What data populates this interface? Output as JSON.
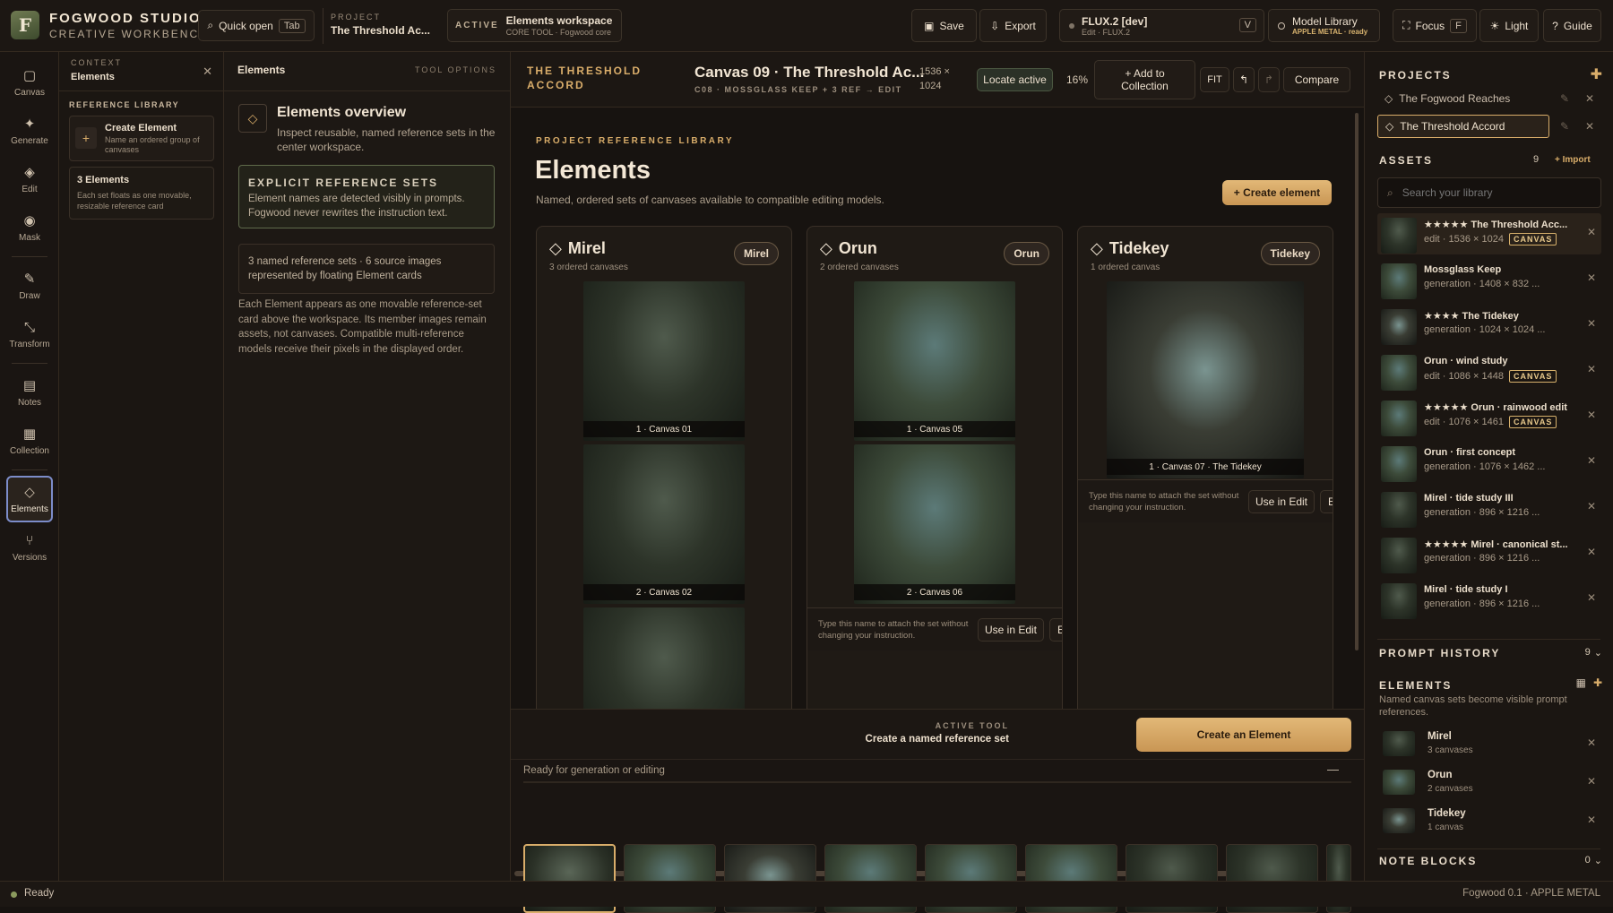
{
  "topbar": {
    "brand_title": "FOGWOOD STUDIO",
    "brand_sub": "CREATIVE WORKBENCH",
    "logo_letter": "F",
    "quick_open": "Quick open",
    "quick_open_key": "Tab",
    "project_label": "PROJECT",
    "project_name": "The Threshold Ac...",
    "active_label": "ACTIVE",
    "active_title": "Elements workspace",
    "active_sub": "CORE TOOL · Fogwood core",
    "save": "Save",
    "export": "Export",
    "model_name": "FLUX.2 [dev]",
    "model_sub": "Edit · FLUX.2",
    "model_key": "V",
    "library_title": "Model Library",
    "library_sub": "APPLE METAL · ready",
    "focus": "Focus",
    "focus_key": "F",
    "light": "Light",
    "guide": "Guide"
  },
  "rail": [
    {
      "icon": "canvas-icon",
      "glyph": "▢",
      "label": "Canvas"
    },
    {
      "icon": "generate-icon",
      "glyph": "✦",
      "label": "Generate"
    },
    {
      "icon": "edit-icon",
      "glyph": "◈",
      "label": "Edit"
    },
    {
      "icon": "mask-icon",
      "glyph": "◉",
      "label": "Mask"
    },
    {
      "icon": "draw-icon",
      "glyph": "✎",
      "label": "Draw"
    },
    {
      "icon": "transform-icon",
      "glyph": "⤡",
      "label": "Transform"
    },
    {
      "icon": "notes-icon",
      "glyph": "▤",
      "label": "Notes"
    },
    {
      "icon": "collection-icon",
      "glyph": "▦",
      "label": "Collection"
    },
    {
      "icon": "elements-icon",
      "glyph": "◇",
      "label": "Elements"
    },
    {
      "icon": "versions-icon",
      "glyph": "⑂",
      "label": "Versions"
    }
  ],
  "context": {
    "label": "CONTEXT",
    "title": "Elements",
    "section": "REFERENCE LIBRARY",
    "create_title": "Create Element",
    "create_desc": "Name an ordered group of canvases",
    "count_title": "3 Elements",
    "count_desc": "Each set floats as one movable, resizable reference card"
  },
  "tool": {
    "title": "Elements",
    "options": "TOOL OPTIONS",
    "overview_title": "Elements overview",
    "overview_desc": "Inspect reusable, named reference sets in the center workspace.",
    "explicit_title": "EXPLICIT REFERENCE SETS",
    "explicit_desc": "Element names are detected visibly in prompts. Fogwood never rewrites the instruction text.",
    "stats": "3 named reference sets · 6 source images represented by floating Element cards",
    "body": "Each Element appears as one movable reference-set card above the workspace. Its member images remain assets, not canvases. Compatible multi-reference models receive their pixels in the displayed order."
  },
  "center": {
    "project_caps": "THE THRESHOLD ACCORD",
    "canvas_title": "Canvas 09 · The Threshold Ac...",
    "canvas_sub": "C08 · MOSSGLASS KEEP + 3 REF → EDIT",
    "dims": "1536 × 1024",
    "locate": "Locate active",
    "zoom": "16%",
    "add_collection": "+ Add to Collection",
    "fit": "FIT",
    "compare": "Compare",
    "lib_caps": "PROJECT REFERENCE LIBRARY",
    "heading": "Elements",
    "subheading": "Named, ordered sets of canvases available to compatible editing models.",
    "create_element": "+ Create element",
    "card_hint": "Type this name to attach the set without changing your instruction.",
    "use_in_edit": "Use in Edit",
    "more": "E",
    "cards": [
      {
        "name": "Mirel",
        "count": "3 ordered canvases",
        "pill": "Mirel",
        "captions": [
          "1 · Canvas 01",
          "2 · Canvas 02",
          ""
        ]
      },
      {
        "name": "Orun",
        "count": "2 ordered canvases",
        "pill": "Orun",
        "captions": [
          "1 · Canvas 05",
          "2 · Canvas 06"
        ]
      },
      {
        "name": "Tidekey",
        "count": "1 ordered canvas",
        "pill": "Tidekey",
        "captions": [
          "1 · Canvas 07 · The Tidekey"
        ]
      }
    ],
    "active_tool_label": "ACTIVE TOOL",
    "active_tool_desc": "Create a named reference set",
    "create_an_element": "Create an Element",
    "status": "Ready for generation or editing",
    "minimize": "—"
  },
  "right": {
    "projects_title": "PROJECTS",
    "projects": [
      "The Fogwood Reaches",
      "The Threshold Accord"
    ],
    "assets_title": "ASSETS",
    "assets_count": "9",
    "import": "+ Import",
    "search_placeholder": "Search your library",
    "assets": [
      {
        "title": "★★★★★ The Threshold Acc...",
        "sub": "edit · 1536 × 1024",
        "badge": "CANVAS"
      },
      {
        "title": "Mossglass Keep",
        "sub": "generation · 1408 × 832 ...",
        "badge": ""
      },
      {
        "title": "★★★★ The Tidekey",
        "sub": "generation · 1024 × 1024 ...",
        "badge": ""
      },
      {
        "title": "Orun · wind study",
        "sub": "edit · 1086 × 1448",
        "badge": "CANVAS"
      },
      {
        "title": "★★★★★ Orun · rainwood edit",
        "sub": "edit · 1076 × 1461",
        "badge": "CANVAS"
      },
      {
        "title": "Orun · first concept",
        "sub": "generation · 1076 × 1462 ...",
        "badge": ""
      },
      {
        "title": "Mirel · tide study III",
        "sub": "generation · 896 × 1216 ...",
        "badge": ""
      },
      {
        "title": "★★★★★ Mirel · canonical st...",
        "sub": "generation · 896 × 1216 ...",
        "badge": ""
      },
      {
        "title": "Mirel · tide study I",
        "sub": "generation · 896 × 1216 ...",
        "badge": ""
      }
    ],
    "prompt_history_title": "PROMPT HISTORY",
    "prompt_history_count": "9",
    "elements_title": "ELEMENTS",
    "elements_desc": "Named canvas sets become visible prompt references.",
    "elements": [
      {
        "name": "Mirel",
        "count": "3 canvases"
      },
      {
        "name": "Orun",
        "count": "2 canvases"
      },
      {
        "name": "Tidekey",
        "count": "1 canvas"
      }
    ],
    "note_blocks_title": "NOTE BLOCKS",
    "note_blocks_count": "0"
  },
  "statusbar": {
    "state": "Ready",
    "version": "Fogwood 0.1 · APPLE METAL"
  },
  "colors": {
    "accent": "#d9ad6a",
    "background": "#171310",
    "panel": "#1d1814",
    "border": "#3a3027",
    "active_outline": "#7c8cc9"
  }
}
